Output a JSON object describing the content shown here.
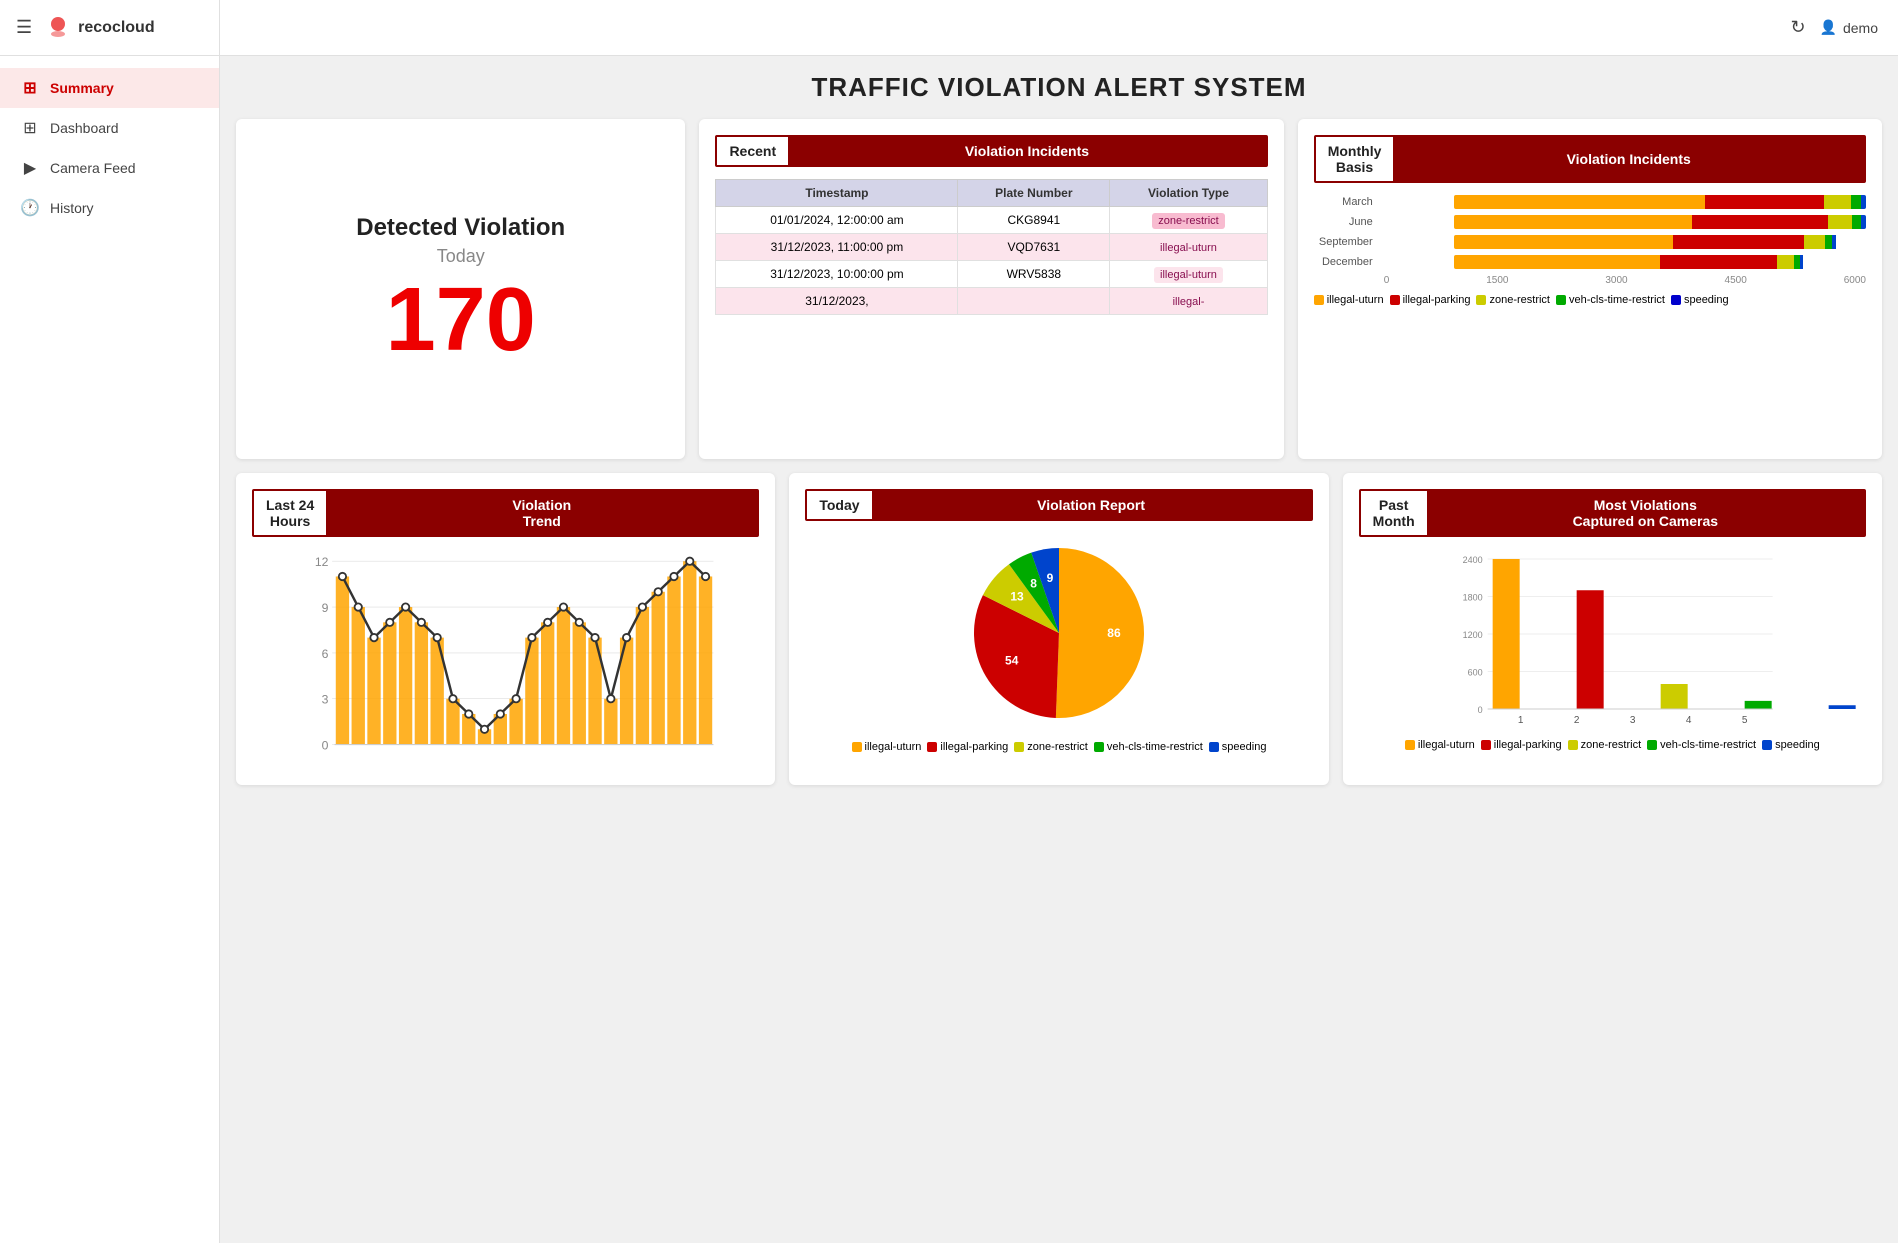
{
  "app": {
    "title": "recocloud",
    "user": "demo"
  },
  "page_title": "TRAFFIC VIOLATION ALERT SYSTEM",
  "sidebar": {
    "items": [
      {
        "label": "Summary",
        "icon": "⊞",
        "active": true
      },
      {
        "label": "Dashboard",
        "icon": "⊞",
        "active": false
      },
      {
        "label": "Camera Feed",
        "icon": "▶",
        "active": false
      },
      {
        "label": "History",
        "icon": "🕐",
        "active": false
      }
    ]
  },
  "detected_violation": {
    "title": "Detected Violation",
    "subtitle": "Today",
    "count": "170"
  },
  "recent_violations": {
    "header_left": "Recent",
    "header_right": "Violation Incidents",
    "columns": [
      "Timestamp",
      "Plate Number",
      "Violation Type"
    ],
    "rows": [
      {
        "timestamp": "01/01/2024, 12:00:00 am",
        "plate": "CKG8941",
        "type": "zone-restrict"
      },
      {
        "timestamp": "31/12/2023, 11:00:00 pm",
        "plate": "VQD7631",
        "type": "illegal-uturn"
      },
      {
        "timestamp": "31/12/2023, 10:00:00 pm",
        "plate": "WRV5838",
        "type": "illegal-uturn"
      },
      {
        "timestamp": "31/12/2023,",
        "plate": "",
        "type": "illegal-"
      }
    ]
  },
  "monthly_violations": {
    "header_left": "Monthly\nBasis",
    "header_right": "Violation Incidents",
    "rows": [
      {
        "label": "March",
        "illegal_uturn": 3800,
        "illegal_parking": 1800,
        "zone_restrict": 400,
        "veh_cls": 150,
        "speeding": 80
      },
      {
        "label": "June",
        "illegal_uturn": 3500,
        "illegal_parking": 2000,
        "zone_restrict": 350,
        "veh_cls": 130,
        "speeding": 70
      },
      {
        "label": "September",
        "illegal_uturn": 3200,
        "illegal_parking": 1900,
        "zone_restrict": 300,
        "veh_cls": 100,
        "speeding": 60
      },
      {
        "label": "December",
        "illegal_uturn": 3000,
        "illegal_parking": 1700,
        "zone_restrict": 250,
        "veh_cls": 90,
        "speeding": 50
      }
    ],
    "x_labels": [
      "0",
      "1500",
      "3000",
      "4500",
      "6000"
    ],
    "legend": [
      {
        "label": "illegal-uturn",
        "color": "#FFA500"
      },
      {
        "label": "illegal-parking",
        "color": "#CC0000"
      },
      {
        "label": "zone-restrict",
        "color": "#CCCC00"
      },
      {
        "label": "veh-cls-time-restrict",
        "color": "#00AA00"
      },
      {
        "label": "speeding",
        "color": "#0000CC"
      }
    ]
  },
  "violation_trend": {
    "header_left": "Last 24\nHours",
    "header_right": "Violation Trend",
    "y_labels": [
      "12",
      "9",
      "6",
      "3",
      "0"
    ],
    "bars": [
      11,
      9,
      7,
      8,
      9,
      8,
      7,
      3,
      2,
      1,
      2,
      3,
      7,
      8,
      9,
      8,
      7,
      3,
      7,
      9,
      10,
      11,
      12,
      11
    ]
  },
  "today_report": {
    "header_left": "Today",
    "header_right": "Violation Report",
    "segments": [
      {
        "label": "illegal-uturn",
        "value": 86,
        "color": "#FFA500",
        "percentage": 0.52
      },
      {
        "label": "illegal-parking",
        "value": 54,
        "color": "#CC0000",
        "percentage": 0.33
      },
      {
        "label": "zone-restrict",
        "value": 13,
        "color": "#CCCC00",
        "percentage": 0.08
      },
      {
        "label": "veh-cls-time-restrict",
        "value": 8,
        "color": "#00AA00",
        "percentage": 0.05
      },
      {
        "label": "speeding",
        "value": 9,
        "color": "#0044CC",
        "percentage": 0.055
      }
    ],
    "legend": [
      {
        "label": "illegal-uturn",
        "color": "#FFA500"
      },
      {
        "label": "illegal-parking",
        "color": "#CC0000"
      },
      {
        "label": "zone-restrict",
        "color": "#CCCC00"
      },
      {
        "label": "veh-cls-time-restrict",
        "color": "#00AA00"
      },
      {
        "label": "speeding",
        "color": "#0044CC"
      }
    ]
  },
  "camera_violations": {
    "header_left": "Past\nMonth",
    "header_right": "Most Violations\nCaptured on Cameras",
    "y_labels": [
      "2400",
      "1800",
      "1200",
      "600",
      "0"
    ],
    "cameras": [
      {
        "id": "1",
        "illegal_uturn": 2400,
        "illegal_parking": 0,
        "zone_restrict": 0,
        "veh_cls": 0,
        "speeding": 0
      },
      {
        "id": "2",
        "illegal_uturn": 0,
        "illegal_parking": 1900,
        "zone_restrict": 0,
        "veh_cls": 0,
        "speeding": 0
      },
      {
        "id": "3",
        "illegal_uturn": 0,
        "illegal_parking": 0,
        "zone_restrict": 400,
        "veh_cls": 0,
        "speeding": 0
      },
      {
        "id": "4",
        "illegal_uturn": 0,
        "illegal_parking": 0,
        "zone_restrict": 0,
        "veh_cls": 130,
        "speeding": 0
      },
      {
        "id": "5",
        "illegal_uturn": 0,
        "illegal_parking": 0,
        "zone_restrict": 0,
        "veh_cls": 0,
        "speeding": 60
      }
    ],
    "legend": [
      {
        "label": "illegal-uturn",
        "color": "#FFA500"
      },
      {
        "label": "illegal-parking",
        "color": "#CC0000"
      },
      {
        "label": "zone-restrict",
        "color": "#CCCC00"
      },
      {
        "label": "veh-cls-time-restrict",
        "color": "#00AA00"
      },
      {
        "label": "speeding",
        "color": "#0044CC"
      }
    ]
  }
}
